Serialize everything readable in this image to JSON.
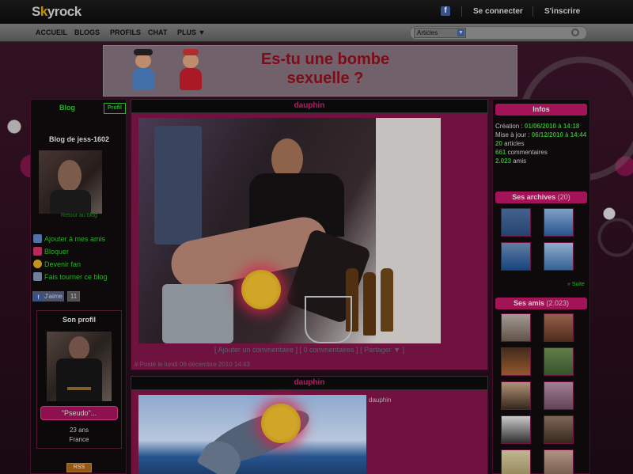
{
  "topbar": {
    "logo": "Skyrock",
    "fb_glyph": "f",
    "connect": "Se connecter",
    "signup": "S'inscrire"
  },
  "nav": {
    "items": [
      "ACCUEIL",
      "BLOGS",
      "PROFILS",
      "CHAT",
      "PLUS ▼"
    ],
    "search_select": "Articles"
  },
  "banner": {
    "line1": "Es-tu une bombe",
    "line2": "sexuelle ?"
  },
  "left": {
    "tab_blog": "Blog",
    "tab_profil": "Profil",
    "blog_title": "Blog de jess-1602",
    "photo_caption": "Retour au blog",
    "actions": [
      "Ajouter à mes amis",
      "Bloquer",
      "Devenir fan",
      "Fais tourner ce blog"
    ],
    "like_label": "J'aime",
    "like_count": "11",
    "profil_title": "Son profil",
    "pseudo_button": "\"Pseudo\"...",
    "age": "23 ans",
    "country": "France",
    "rss": "RSS"
  },
  "articles": [
    {
      "title": "dauphin",
      "links": "[ Ajouter un commentaire ] [ 0 commentaires ] [ Partager ▼ ]",
      "date": "# Posté le lundi 06 décembre 2010 14:43"
    },
    {
      "title": "dauphin",
      "caption": "dauphin"
    }
  ],
  "right": {
    "infos_title": "Infos",
    "creation_label": "Création : ",
    "creation_value": "01/06/2010 à 14:18",
    "maj_label": "Mise à jour : ",
    "maj_value": "06/12/2010 à 14:44",
    "articles_count": "20",
    "articles_label": " articles",
    "comments_count": "661",
    "comments_label": " commentaires",
    "friends_count": "2.023",
    "friends_label": " amis",
    "archives_title": "Ses archives",
    "archives_count": "(20)",
    "suite": "» Suite",
    "friends_title": "Ses amis",
    "friends_box_count": "(2.023)"
  },
  "colors": {
    "accent": "#b11560",
    "green": "#2fbf2f",
    "topbar": "#0c0c0c"
  }
}
